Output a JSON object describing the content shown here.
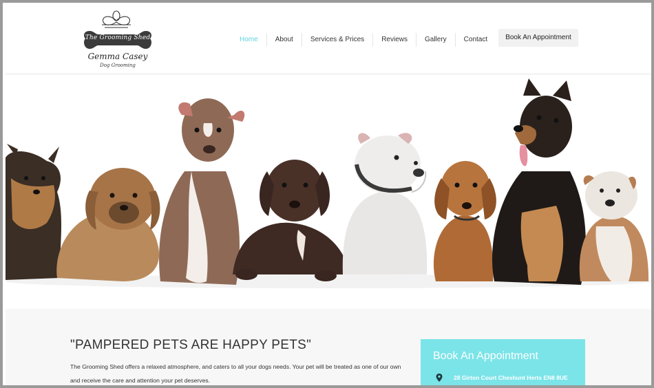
{
  "brand": {
    "badge_text": "The Grooming Shed",
    "name": "Gemma Casey",
    "subtitle": "Dog Grooming"
  },
  "nav": {
    "items": [
      {
        "label": "Home",
        "active": true
      },
      {
        "label": "About",
        "active": false
      },
      {
        "label": "Services & Prices",
        "active": false
      },
      {
        "label": "Reviews",
        "active": false
      },
      {
        "label": "Gallery",
        "active": false
      },
      {
        "label": "Contact",
        "active": false
      }
    ],
    "cta_label": "Book An Appointment"
  },
  "hero": {
    "image": "row-of-puppies",
    "controls": [
      "chevron-left-icon",
      "chevron-right-icon"
    ]
  },
  "main": {
    "tagline": "\"PAMPERED PETS ARE HAPPY PETS\"",
    "intro_line1": "The Grooming Shed offers a relaxed atmosphere, and caters to all your dogs needs. Your pet will be treated as one of our own",
    "intro_line2": "and receive the care and attention your pet deserves."
  },
  "appointment_card": {
    "title": "Book An Appointment",
    "address": "28 Girton Court Cheshunt Herts EN8 8UE",
    "icon": "map-pin-icon"
  },
  "colors": {
    "accent": "#5ed3df",
    "card": "#7be4e8",
    "text": "#333333"
  }
}
